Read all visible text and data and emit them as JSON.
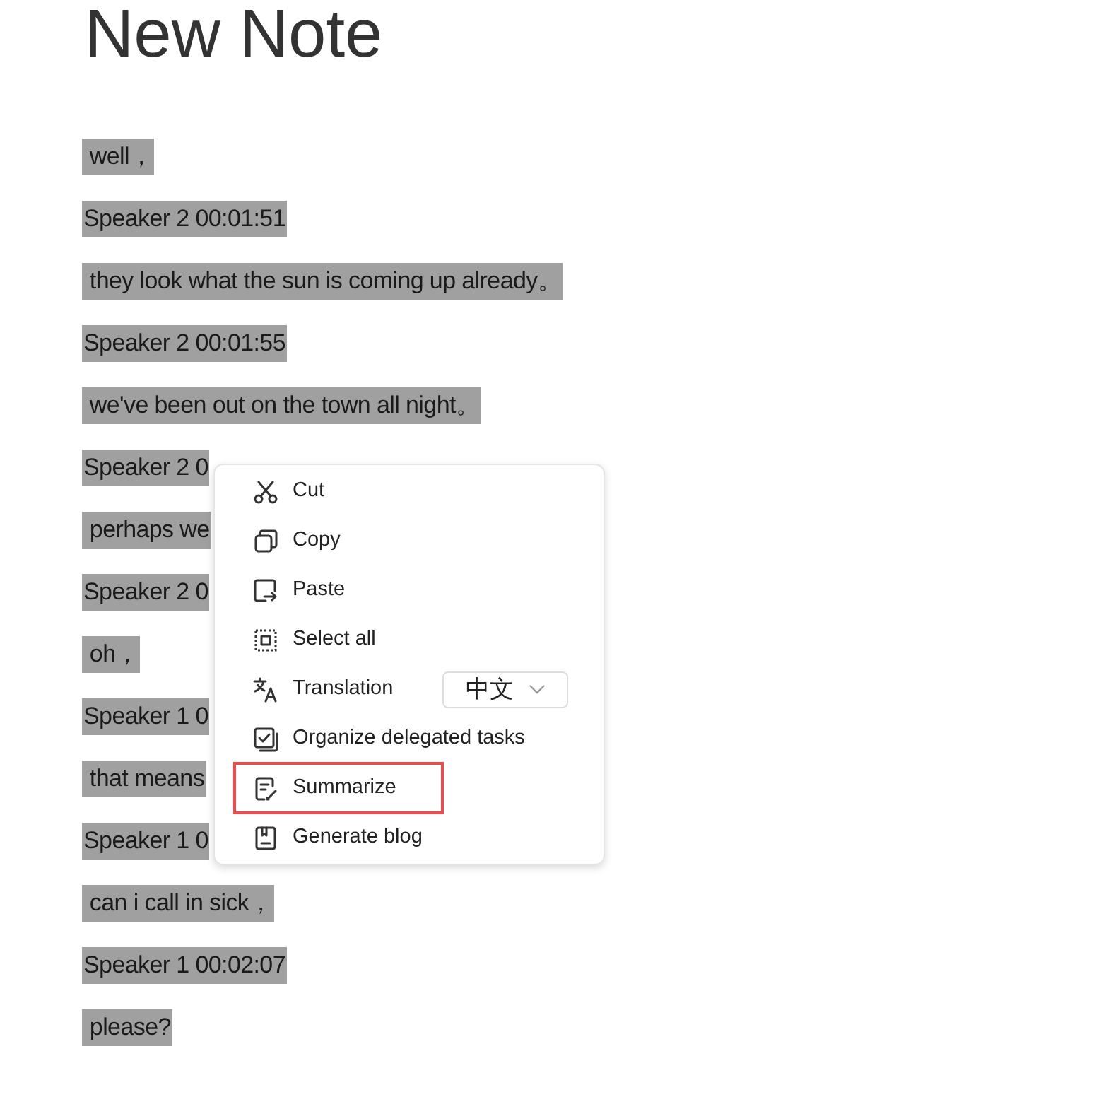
{
  "note": {
    "title": "New Note",
    "lines": [
      {
        "text": " well，"
      },
      {
        "text": "Speaker 2 00:01:51"
      },
      {
        "text": " they look what the sun is coming up already。"
      },
      {
        "text": "Speaker 2 00:01:55"
      },
      {
        "text": " we've been out on the town all night。"
      },
      {
        "text": "Speaker 2 0"
      },
      {
        "text": " perhaps we"
      },
      {
        "text": "Speaker 2 0"
      },
      {
        "text": " oh，"
      },
      {
        "text": "Speaker 1 0"
      },
      {
        "text": " that means"
      },
      {
        "text": "Speaker 1 0"
      },
      {
        "text": " can i call in sick，"
      },
      {
        "text": "Speaker 1 00:02:07"
      },
      {
        "text": " please?"
      }
    ]
  },
  "context_menu": {
    "items": [
      {
        "kind": "item",
        "label": "Cut",
        "outlined": false
      },
      {
        "kind": "item",
        "label": "Copy",
        "outlined": false
      },
      {
        "kind": "item",
        "label": "Paste",
        "outlined": false
      },
      {
        "kind": "item",
        "label": "Select all",
        "outlined": false
      },
      {
        "kind": "dropdown",
        "label": "Translation",
        "value": "中文",
        "outlined": false
      },
      {
        "kind": "item",
        "label": "Organize delegated tasks",
        "outlined": false
      },
      {
        "kind": "item",
        "label": "Summarize",
        "outlined": true
      },
      {
        "kind": "item",
        "label": "Generate blog",
        "outlined": false
      }
    ]
  }
}
